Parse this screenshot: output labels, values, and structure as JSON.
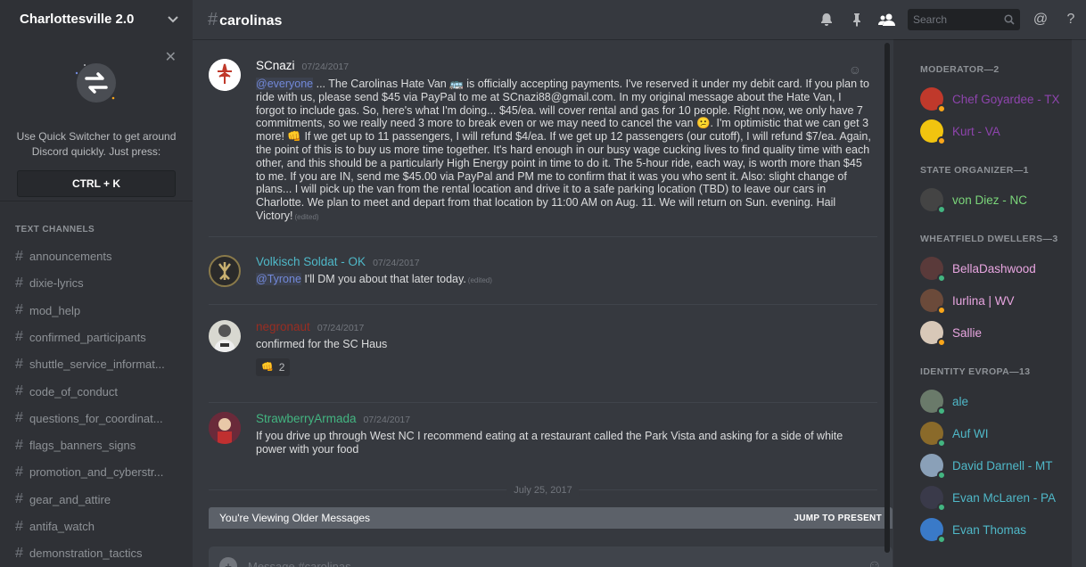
{
  "server": {
    "name": "Charlottesville 2.0"
  },
  "switcher": {
    "tip_line1": "Use Quick Switcher to get around",
    "tip_line2": "Discord quickly. Just press:",
    "shortcut": "CTRL + K"
  },
  "sidebar": {
    "category": "TEXT CHANNELS",
    "channels": [
      "announcements",
      "dixie-lyrics",
      "mod_help",
      "confirmed_participants",
      "shuttle_service_informat...",
      "code_of_conduct",
      "questions_for_coordinat...",
      "flags_banners_signs",
      "promotion_and_cyberstr...",
      "gear_and_attire",
      "antifa_watch",
      "demonstration_tactics"
    ]
  },
  "header": {
    "channel": "carolinas",
    "search_placeholder": "Search"
  },
  "messages": [
    {
      "author": "SCnazi",
      "color": "#ffffff",
      "time": "07/24/2017",
      "mention": "@everyone",
      "text": "... The Carolinas Hate Van 🚌 is officially accepting payments. I've reserved it under my debit card. If you plan to ride with us, please send $45 via PayPal to me at SCnazi88@gmail.com. In my original message about the Hate Van, I forgot to include gas. So, here's what I'm doing... $45/ea. will cover rental and gas for 10 people. Right now, we only have 7 commitments, so we really need 3 more to break even or we may need to cancel the van 😕. I'm optimistic that we can get 3 more! 👊 If we get up to 11 passengers, I will refund $4/ea. If we get up 12 passengers (our cutoff), I will refund $7/ea. Again, the point of this is to buy us more time together. It's hard enough in our busy wage cucking lives to find quality time with each other, and this should be a particularly High Energy point in time to do it. The 5-hour ride, each way, is worth more than $45 to me. If you are IN, send me $45.00 via PayPal and PM me to confirm that it was you who sent it. Also: slight change of plans... I will pick up the van from the rental location and drive it to a safe parking location (TBD) to leave our cars in Charlotte. We plan to meet and depart from that location by 11:00 AM on Aug. 11. We will return on Sun. evening. Hail Victory!",
      "edited": "(edited)"
    },
    {
      "author": "Volkisch Soldat - OK",
      "color": "#4fb8c8",
      "time": "07/24/2017",
      "mention": "@Tyrone",
      "text": " I'll DM you about that later today.",
      "edited": "(edited)"
    },
    {
      "author": "negronaut",
      "color": "#992d22",
      "time": "07/24/2017",
      "text": "confirmed for the SC Haus",
      "reaction": {
        "emoji": "👊",
        "count": "2"
      }
    },
    {
      "author": "StrawberryArmada",
      "color": "#43b581",
      "time": "07/24/2017",
      "text": "If you drive up through West NC I recommend eating at a restaurant called the Park Vista and asking for a side of white power with your food"
    }
  ],
  "divider": "July 25, 2017",
  "older_bar": {
    "text": "You're Viewing Older Messages",
    "jump": "JUMP TO PRESENT"
  },
  "composer": {
    "placeholder": "Message #carolinas"
  },
  "members": [
    {
      "role": "MODERATOR—2",
      "list": [
        {
          "name": "Chef Goyardee - TX",
          "color": "#8e44ad",
          "status": "#faa61a",
          "av": "#c0392b"
        },
        {
          "name": "Kurt - VA",
          "color": "#8e44ad",
          "status": "#faa61a",
          "av": "#f1c40f"
        }
      ]
    },
    {
      "role": "STATE ORGANIZER—1",
      "list": [
        {
          "name": "von Diez - NC",
          "color": "#7bd67a",
          "status": "#43b581",
          "av": "#444"
        }
      ]
    },
    {
      "role": "WHEATFIELD DWELLERS—3",
      "list": [
        {
          "name": "BellaDashwood",
          "color": "#e8a5e0",
          "status": "#43b581",
          "av": "#5a3a3a"
        },
        {
          "name": "Iurlina | WV",
          "color": "#e8a5e0",
          "status": "#faa61a",
          "av": "#6b4a3a"
        },
        {
          "name": "Sallie",
          "color": "#e8a5e0",
          "status": "#faa61a",
          "av": "#d8c8b8"
        }
      ]
    },
    {
      "role": "IDENTITY EVROPA—13",
      "list": [
        {
          "name": "ale",
          "color": "#4fb8c8",
          "status": "#43b581",
          "av": "#6a7a6a"
        },
        {
          "name": "Auf WI",
          "color": "#4fb8c8",
          "status": "#43b581",
          "av": "#8a6a2a"
        },
        {
          "name": "David Darnell - MT",
          "color": "#4fb8c8",
          "status": "#43b581",
          "av": "#8aa0b8"
        },
        {
          "name": "Evan McLaren - PA",
          "color": "#4fb8c8",
          "status": "#43b581",
          "av": "#3a3a4a"
        },
        {
          "name": "Evan Thomas",
          "color": "#4fb8c8",
          "status": "#43b581",
          "av": "#3a7ac8"
        }
      ]
    }
  ]
}
